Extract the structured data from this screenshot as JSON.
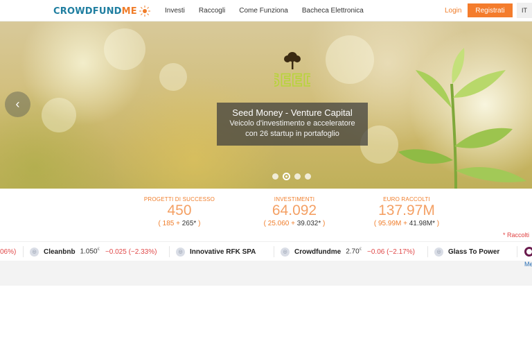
{
  "brand": {
    "name_part1": "CROWDFUND",
    "name_part2": "ME"
  },
  "nav": {
    "items": [
      "Investi",
      "Raccogli",
      "Come Funziona",
      "Bacheca Elettronica"
    ],
    "login": "Login",
    "register": "Registrati",
    "language": "IT"
  },
  "hero": {
    "title": "Seed Money - Venture Capital",
    "subtitle_line1": "Veicolo d'investimento e acceleratore",
    "subtitle_line2": "con 26 startup in portafoglio",
    "prev_icon": "chevron-left-icon",
    "prev_glyph": "‹",
    "slides_count": 4,
    "active_slide": 2
  },
  "stats": [
    {
      "label": "PROGETTI DI SUCCESSO",
      "value": "450",
      "open": "( 185 + ",
      "extra": "265*",
      "close": " )"
    },
    {
      "label": "INVESTIMENTI",
      "value": "64.092",
      "open": "( 25.060 + ",
      "extra": "39.032*",
      "close": " )"
    },
    {
      "label": "EURO RACCOLTI",
      "value": "137.97M",
      "open": "( 95.99M + ",
      "extra": "41.98M*",
      "close": " )"
    }
  ],
  "footnote": "* Raccolti",
  "ticker": [
    {
      "name": "",
      "price": "",
      "change": "06%)"
    },
    {
      "name": "Cleanbnb",
      "price": "1.050",
      "unit": "€",
      "change": "−0.025 (−2.33%)"
    },
    {
      "name": "Innovative RFK SPA",
      "price": "",
      "unit": "",
      "change": ""
    },
    {
      "name": "Crowdfundme",
      "price": "2.70",
      "unit": "€",
      "change": "−0.06 (−2.17%)"
    },
    {
      "name": "Glass To Power",
      "price": "",
      "unit": "",
      "change": ""
    }
  ],
  "more_link": "Me",
  "colors": {
    "brand_blue": "#1f7ea0",
    "brand_orange": "#f07d2a",
    "negative": "#e04848"
  }
}
